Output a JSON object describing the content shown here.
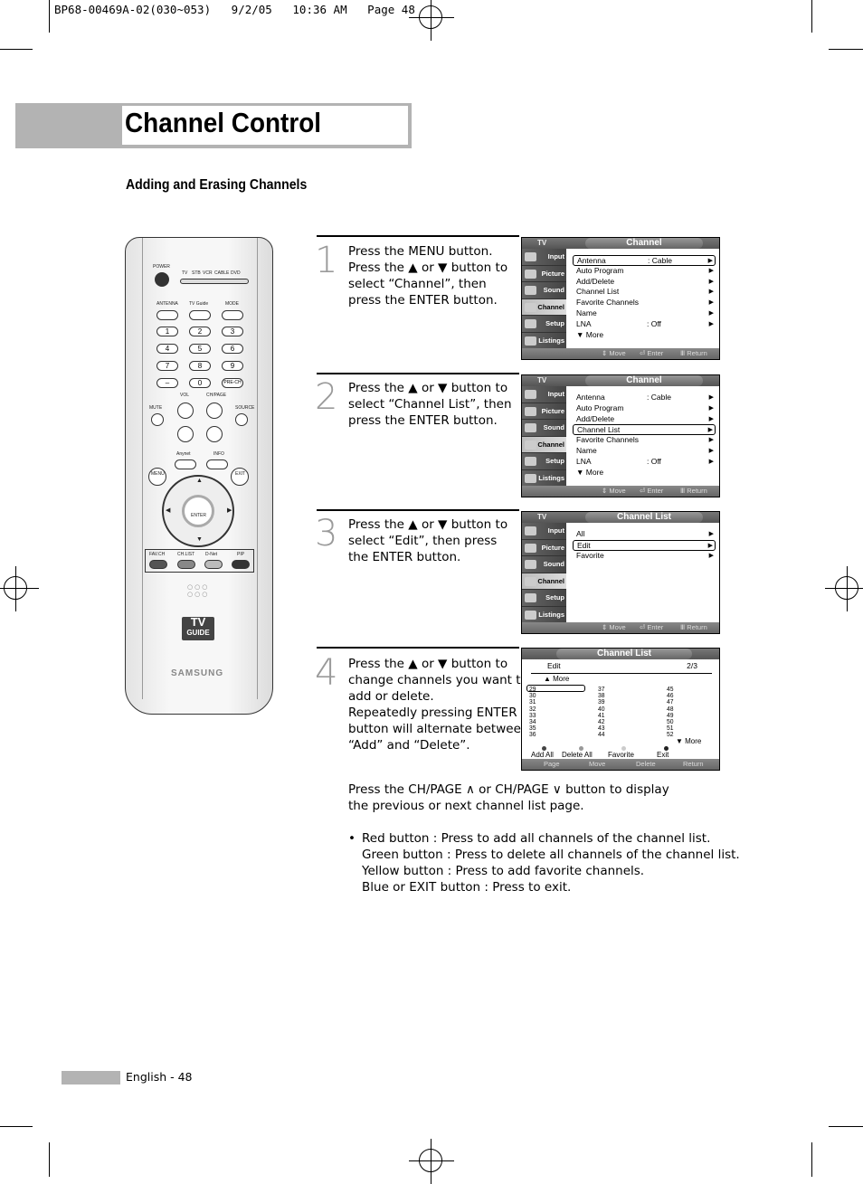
{
  "slug": "BP68-00469A-02(030~053)   9/2/05   10:36 AM   Page 48",
  "header": {
    "title": "Channel Control",
    "subtitle": "Adding and Erasing Channels"
  },
  "remote": {
    "power_label": "POWER",
    "mode_labels": [
      "TV",
      "STB",
      "VCR",
      "CABLE",
      "DVD"
    ],
    "top_buttons": [
      "ANTENNA",
      "TV Guide",
      "MODE"
    ],
    "number_keys": [
      "1",
      "2",
      "3",
      "4",
      "5",
      "6",
      "7",
      "8",
      "9",
      "–",
      "0",
      "PRE-CH"
    ],
    "vol_label": "VOL",
    "chpage_label": "CH/PAGE",
    "mute_label": "MUTE",
    "source_label": "SOURCE",
    "anynet_label": "Anynet",
    "info_label": "INFO",
    "menu_label": "MENU",
    "exit_label": "EXIT",
    "enter_label": "ENTER",
    "color_buttons": [
      {
        "label": "FAV.CH",
        "color": "#555555"
      },
      {
        "label": "CH.LIST",
        "color": "#888888"
      },
      {
        "label": "D-Net",
        "color": "#bbbbbb"
      },
      {
        "label": "PIP",
        "color": "#333333"
      }
    ],
    "tvguide_logo": [
      "TV",
      "GUIDE"
    ],
    "brand": "SAMSUNG"
  },
  "steps": [
    {
      "number": "1",
      "text": "Press the MENU button.\nPress the ▲ or ▼ button to select “Channel”, then press the ENTER button.",
      "screen": {
        "title": "Channel",
        "selected_side": "Channel",
        "rows": [
          {
            "label": "Antenna",
            "value": ": Cable",
            "arrow": "▶",
            "selected": true
          },
          {
            "label": "Auto Program",
            "value": "",
            "arrow": "▶"
          },
          {
            "label": "Add/Delete",
            "value": "",
            "arrow": "▶"
          },
          {
            "label": "Channel List",
            "value": "",
            "arrow": "▶"
          },
          {
            "label": "Favorite Channels",
            "value": "",
            "arrow": "▶"
          },
          {
            "label": "Name",
            "value": "",
            "arrow": "▶"
          },
          {
            "label": "LNA",
            "value": ": Off",
            "arrow": "▶"
          },
          {
            "label": "▼ More",
            "value": "",
            "arrow": ""
          }
        ]
      }
    },
    {
      "number": "2",
      "text": "Press the ▲ or ▼ button to select “Channel List”, then press the ENTER button.",
      "screen": {
        "title": "Channel",
        "selected_side": "Channel",
        "rows": [
          {
            "label": "Antenna",
            "value": ": Cable",
            "arrow": "▶"
          },
          {
            "label": "Auto Program",
            "value": "",
            "arrow": "▶"
          },
          {
            "label": "Add/Delete",
            "value": "",
            "arrow": "▶"
          },
          {
            "label": "Channel List",
            "value": "",
            "arrow": "▶",
            "selected": true
          },
          {
            "label": "Favorite Channels",
            "value": "",
            "arrow": "▶"
          },
          {
            "label": "Name",
            "value": "",
            "arrow": "▶"
          },
          {
            "label": "LNA",
            "value": ": Off",
            "arrow": "▶"
          },
          {
            "label": "▼ More",
            "value": "",
            "arrow": ""
          }
        ]
      }
    },
    {
      "number": "3",
      "text": "Press the ▲ or ▼ button to select “Edit”, then press the ENTER button.",
      "screen": {
        "title": "Channel List",
        "selected_side": "Channel",
        "rows": [
          {
            "label": "All",
            "value": "",
            "arrow": "▶"
          },
          {
            "label": "Edit",
            "value": "",
            "arrow": "▶",
            "selected": true
          },
          {
            "label": "Favorite",
            "value": "",
            "arrow": "▶"
          }
        ]
      }
    },
    {
      "number": "4",
      "text": "Press the ▲ or ▼ button to change channels you want to add or delete.\nRepeatedly pressing ENTER button will alternate between “Add” and “Delete”."
    }
  ],
  "osd_common": {
    "tv_label": "TV",
    "side_menu": [
      "Input",
      "Picture",
      "Sound",
      "Channel",
      "Setup",
      "Listings"
    ],
    "footer": {
      "move": "⇕ Move",
      "enter": "⏎ Enter",
      "return": "Ⅲ Return"
    }
  },
  "edit_screen": {
    "title": "Channel List",
    "mode": "Edit",
    "page": "2/3",
    "more_up": "▲ More",
    "more_down": "▼ More",
    "columns": [
      [
        "29",
        "30",
        "31",
        "32",
        "33",
        "34",
        "35",
        "36"
      ],
      [
        "37",
        "38",
        "39",
        "40",
        "41",
        "42",
        "43",
        "44"
      ],
      [
        "45",
        "46",
        "47",
        "48",
        "49",
        "50",
        "51",
        "52"
      ]
    ],
    "selected_channel": "29",
    "color_actions": [
      {
        "label": "Add All",
        "color": "#444444"
      },
      {
        "label": "Delete All",
        "color": "#999999"
      },
      {
        "label": "Favorite",
        "color": "#cccccc"
      },
      {
        "label": "Exit",
        "color": "#222222"
      }
    ],
    "footer": {
      "page": "Page",
      "move": "Move",
      "delete": "Delete",
      "return": "Return"
    }
  },
  "notes": {
    "chpage_line1": "Press the CH/PAGE ∧ or CH/PAGE ∨ button to display",
    "chpage_line2": "the previous or next channel list page.",
    "bullet": "•",
    "bullets": [
      "Red button : Press to add all channels of the channel list.",
      "Green button : Press to delete all channels of the channel list.",
      "Yellow button : Press to add favorite channels.",
      "Blue or EXIT button : Press to exit."
    ]
  },
  "footer": {
    "page_label": "English - 48"
  }
}
